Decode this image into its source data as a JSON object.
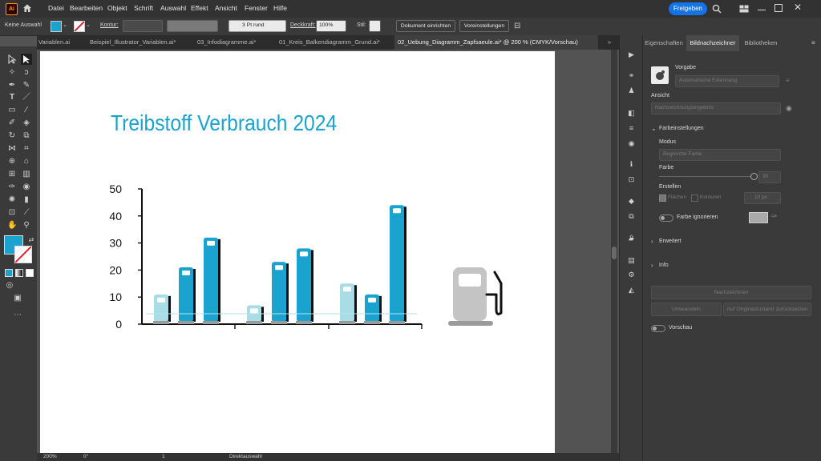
{
  "menubar": {
    "app_logo": "Ai",
    "menus": [
      "Datei",
      "Bearbeiten",
      "Objekt",
      "Schrift",
      "Auswahl",
      "Effekt",
      "Ansicht",
      "Fenster",
      "Hilfe"
    ],
    "share_label": "Freigeben"
  },
  "controlbar": {
    "selection": "Keine Auswahl",
    "fill_color": "#1aa3cf",
    "kontur_label": "Kontur:",
    "stroke_profile": "3 Pt rund",
    "deckkraft_label": "Deckkraft:",
    "deckkraft_value": "100%",
    "stil_label": "Stil:",
    "doc_setup_button": "Dokument einrichten",
    "preferences_button": "Voreinstellungen"
  },
  "tabs": [
    {
      "label": "Variablen.ai",
      "active": false
    },
    {
      "label": "Beispiel_Illustrator_Variablen.ai*",
      "active": false
    },
    {
      "label": "03_Infodiagramme.ai*",
      "active": false
    },
    {
      "label": "01_Kreis_Balkendiagramm_Grund.ai*",
      "active": false
    },
    {
      "label": "02_Uebung_Diagramm_Zapfsaeule.ai* @ 200 % (CMYK/Vorschau)",
      "active": true
    }
  ],
  "tab_overflow": "»",
  "panel": {
    "tabs": [
      "Eigenschaften",
      "Bildnachzeichner",
      "Bibliotheken"
    ],
    "active_tab": "Bildnachzeichner",
    "vorgabe_label": "Vorgabe",
    "vorgabe_value": "Automatische Erkennung",
    "ansicht_label": "Ansicht",
    "ansicht_value": "Nachzeichnungsergebnis",
    "farbeinstellungen": "Farbeinstellungen",
    "modus_label": "Modus",
    "modus_value": "Begrenzte Farbe",
    "farbe_label": "Farbe",
    "farbe_value": "30",
    "erstellen_label": "Erstellen",
    "flaechen_label": "Flächen",
    "konturen_label": "Konturen",
    "konturen_value": "10 px",
    "farbe_ignorieren": "Farbe ignorieren",
    "erweitert": "Erweitert",
    "info": "Info",
    "nachzeichnen_button": "Nachzeichnen",
    "umwandeln_button": "Umwandeln",
    "reset_button": "Auf Originalzustand zurücksetzen",
    "vorschau_label": "Vorschau"
  },
  "statusbar": {
    "zoom": "200%",
    "rotation": "0°",
    "artboard_number": "1",
    "tool_name": "Direktauswahl"
  },
  "artwork_title": "Treibstoff Verbrauch 2024",
  "chart_data": {
    "type": "bar",
    "title": "Treibstoff Verbrauch 2024",
    "ylim": [
      0,
      50
    ],
    "yticks": [
      0,
      10,
      20,
      30,
      40,
      50
    ],
    "groups": [
      {
        "values": [
          11,
          21,
          32
        ]
      },
      {
        "values": [
          7,
          23,
          28
        ]
      },
      {
        "values": [
          15,
          11,
          44
        ]
      }
    ],
    "series_colors": [
      "#a9dde6",
      "#1aa3cf",
      "#1aa3cf"
    ]
  },
  "colors": {
    "accent": "#1473e6",
    "chart_blue": "#1aa3cf",
    "chart_light": "#a9dde6",
    "pump_gray": "#c4c4c4"
  }
}
